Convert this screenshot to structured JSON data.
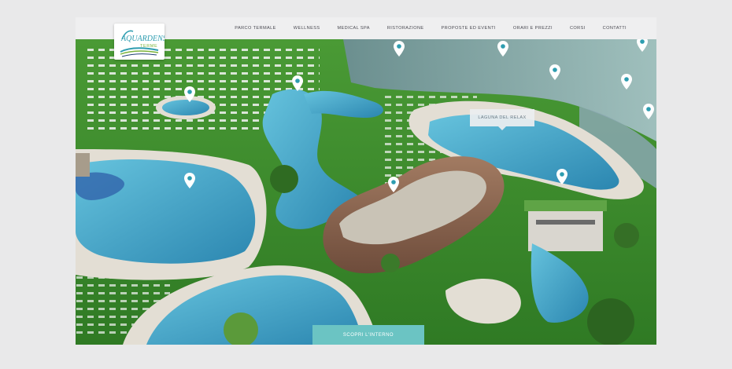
{
  "brand": {
    "name_line1": "AQUARDENS",
    "name_line2": "TERME",
    "colors": {
      "teal": "#2e9db0",
      "green": "#7bb33a",
      "navy": "#1f3f73"
    }
  },
  "nav": {
    "items": [
      "Parco termale",
      "Wellness",
      "Medical spa",
      "Ristorazione",
      "Proposte ed eventi",
      "Orari e prezzi",
      "Corsi",
      "Contatti"
    ]
  },
  "map": {
    "tooltip": "Laguna del relax",
    "cta": "Scopri l'interno",
    "pin_color": "#ffffff",
    "colors": {
      "grass": "#3d8a2e",
      "water": "#3fa6c8",
      "rock": "#8f6a55",
      "path": "#d8d4cc"
    }
  }
}
